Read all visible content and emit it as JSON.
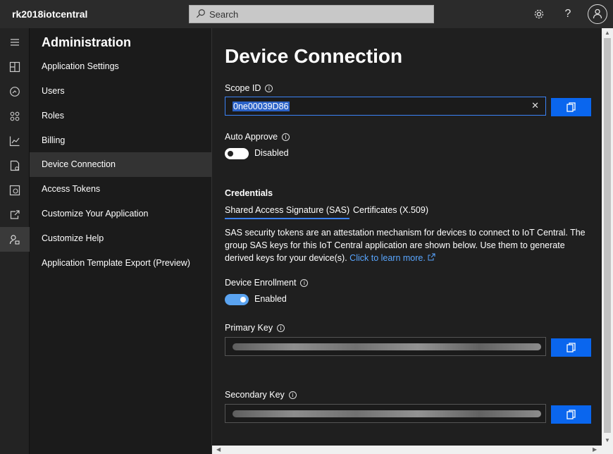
{
  "app": {
    "title": "rk2018iotcentral"
  },
  "search": {
    "placeholder": "Search"
  },
  "nav": {
    "title": "Administration",
    "items": [
      {
        "label": "Application Settings"
      },
      {
        "label": "Users"
      },
      {
        "label": "Roles"
      },
      {
        "label": "Billing"
      },
      {
        "label": "Device Connection"
      },
      {
        "label": "Access Tokens"
      },
      {
        "label": "Customize Your Application"
      },
      {
        "label": "Customize Help"
      },
      {
        "label": "Application Template Export (Preview)"
      }
    ],
    "active": "Device Connection"
  },
  "rail": {
    "icons": [
      "menu-icon",
      "dashboard-icon",
      "analytics-icon",
      "device-sets-icon",
      "chart-icon",
      "device-templates-icon",
      "jobs-icon",
      "export-icon",
      "administration-icon"
    ]
  },
  "main": {
    "title": "Device Connection",
    "scope_id": {
      "label": "Scope ID",
      "value": "0ne00039D86"
    },
    "auto_approve": {
      "label": "Auto Approve",
      "state": "Disabled"
    },
    "credentials": {
      "title": "Credentials",
      "tabs": [
        {
          "label": "Shared Access Signature (SAS)"
        },
        {
          "label": "Certificates (X.509)"
        }
      ],
      "description": "SAS security tokens are an attestation mechanism for devices to connect to IoT Central. The group SAS keys for this IoT Central application are shown below. Use them to generate derived keys for your device(s).",
      "learn_more": "Click to learn more."
    },
    "device_enrollment": {
      "label": "Device Enrollment",
      "state": "Enabled"
    },
    "primary_key": {
      "label": "Primary Key"
    },
    "secondary_key": {
      "label": "Secondary Key"
    }
  },
  "colors": {
    "accent": "#0a66ee",
    "link": "#59a6ff",
    "toggle_on": "#5aa3f0"
  }
}
